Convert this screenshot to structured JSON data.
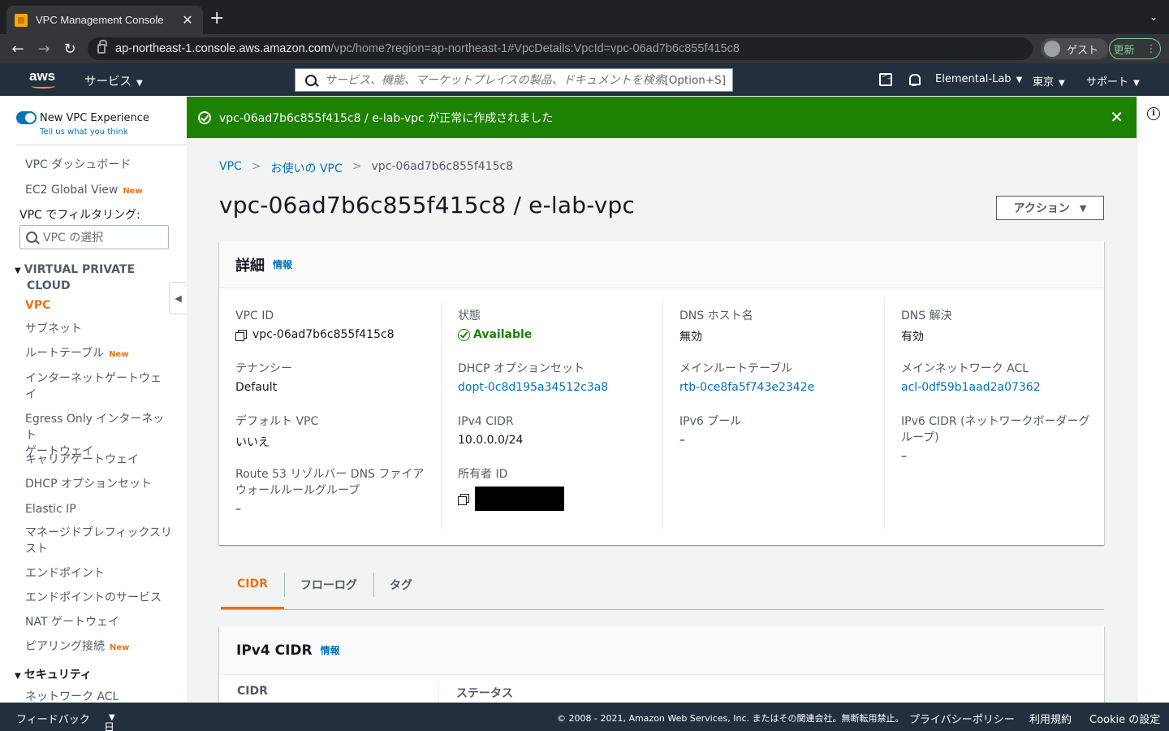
{
  "browser": {
    "tab_title": "VPC Management Console",
    "tab_close": "✕",
    "new_tab": "+",
    "url_host": "ap-northeast-1.console.aws.amazon.com",
    "url_path": "/vpc/home?region=ap-northeast-1#VpcDetails:VpcId=vpc-06ad7b6c855f415c8",
    "profile_label": "ゲスト",
    "update_label": "更新",
    "update_menu": "⋮"
  },
  "aws_header": {
    "logo_text": "aws",
    "services_label": "サービス",
    "search_placeholder": "サービス、機能、マーケットプレイスの製品、ドキュメントを検索",
    "search_shortcut": "[Option+S]",
    "account_label": "Elemental-Lab",
    "region_label": "東京",
    "support_label": "サポート"
  },
  "sidebar": {
    "new_experience_label": "New VPC Experience",
    "feedback_link": "Tell us what you think",
    "dashboard": "VPC ダッシュボード",
    "global_view": "EC2 Global View",
    "new_badge": "New",
    "filter_label": "VPC でフィルタリング:",
    "vpc_select_placeholder": "VPC の選択",
    "section_vpc_line1": "VIRTUAL PRIVATE",
    "section_vpc_line2": "CLOUD",
    "items": {
      "vpc": "VPC",
      "subnets": "サブネット",
      "route_tables": "ルートテーブル",
      "igw_line1": "インターネットゲートウェ",
      "igw_line2": "イ",
      "egress_line1": "Egress Only インターネット",
      "egress_line2": "ゲートウェイ",
      "carrier": "キャリアゲートウェイ",
      "dhcp": "DHCP オプションセット",
      "eip": "Elastic IP",
      "prefix_line1": "マネージドプレフィックスリ",
      "prefix_line2": "スト",
      "endpoints": "エンドポイント",
      "endpoint_services": "エンドポイントのサービス",
      "nat": "NAT ゲートウェイ",
      "peering": "ピアリング接続"
    },
    "section_security": "セキュリティ",
    "network_acl": "ネットワーク ACL"
  },
  "flash": {
    "message": "vpc-06ad7b6c855f415c8 / e-lab-vpc が正常に作成されました"
  },
  "breadcrumb": {
    "root": "VPC",
    "parent": "お使いの VPC",
    "current": "vpc-06ad7b6c855f415c8"
  },
  "page": {
    "title": "vpc-06ad7b6c855f415c8 / e-lab-vpc",
    "actions_label": "アクション"
  },
  "details": {
    "heading": "詳細",
    "info_link": "情報",
    "vpc_id_label": "VPC ID",
    "vpc_id_value": "vpc-06ad7b6c855f415c8",
    "tenancy_label": "テナンシー",
    "tenancy_value": "Default",
    "default_vpc_label": "デフォルト VPC",
    "default_vpc_value": "いいえ",
    "route53_label_line1": "Route 53 リゾルバー DNS ファイア",
    "route53_label_line2": "ウォールルールグループ",
    "route53_value": "–",
    "state_label": "状態",
    "state_value": "Available",
    "dhcp_label": "DHCP オプションセット",
    "dhcp_value": "dopt-0c8d195a34512c3a8",
    "ipv4_cidr_label": "IPv4 CIDR",
    "ipv4_cidr_value": "10.0.0.0/24",
    "owner_label": "所有者 ID",
    "dns_hostname_label": "DNS ホスト名",
    "dns_hostname_value": "無効",
    "main_rt_label": "メインルートテーブル",
    "main_rt_value": "rtb-0ce8fa5f743e2342e",
    "ipv6_pool_label": "IPv6 プール",
    "ipv6_pool_value": "–",
    "dns_resolution_label": "DNS 解決",
    "dns_resolution_value": "有効",
    "main_acl_label": "メインネットワーク ACL",
    "main_acl_value": "acl-0df59b1aad2a07362",
    "ipv6_cidr_label_line1": "IPv6 CIDR (ネットワークボーダーグ",
    "ipv6_cidr_label_line2": "ループ)",
    "ipv6_cidr_value": "–"
  },
  "tabs": [
    "CIDR",
    "フローログ",
    "タグ"
  ],
  "cidr_panel": {
    "heading": "IPv4 CIDR",
    "info_link": "情報",
    "col_cidr": "CIDR",
    "col_status": "ステータス"
  },
  "footer": {
    "feedback": "フィードバック",
    "language": "日本語",
    "copyright": "© 2008 - 2021, Amazon Web Services, Inc. またはその関連会社。無断転用禁止。",
    "privacy": "プライバシーポリシー",
    "terms": "利用規約",
    "cookie": "Cookie の設定"
  },
  "colors": {
    "aws_navy": "#232f3e",
    "success_green": "#1d8102",
    "link_blue": "#0073bb",
    "accent_orange": "#ec7211"
  }
}
